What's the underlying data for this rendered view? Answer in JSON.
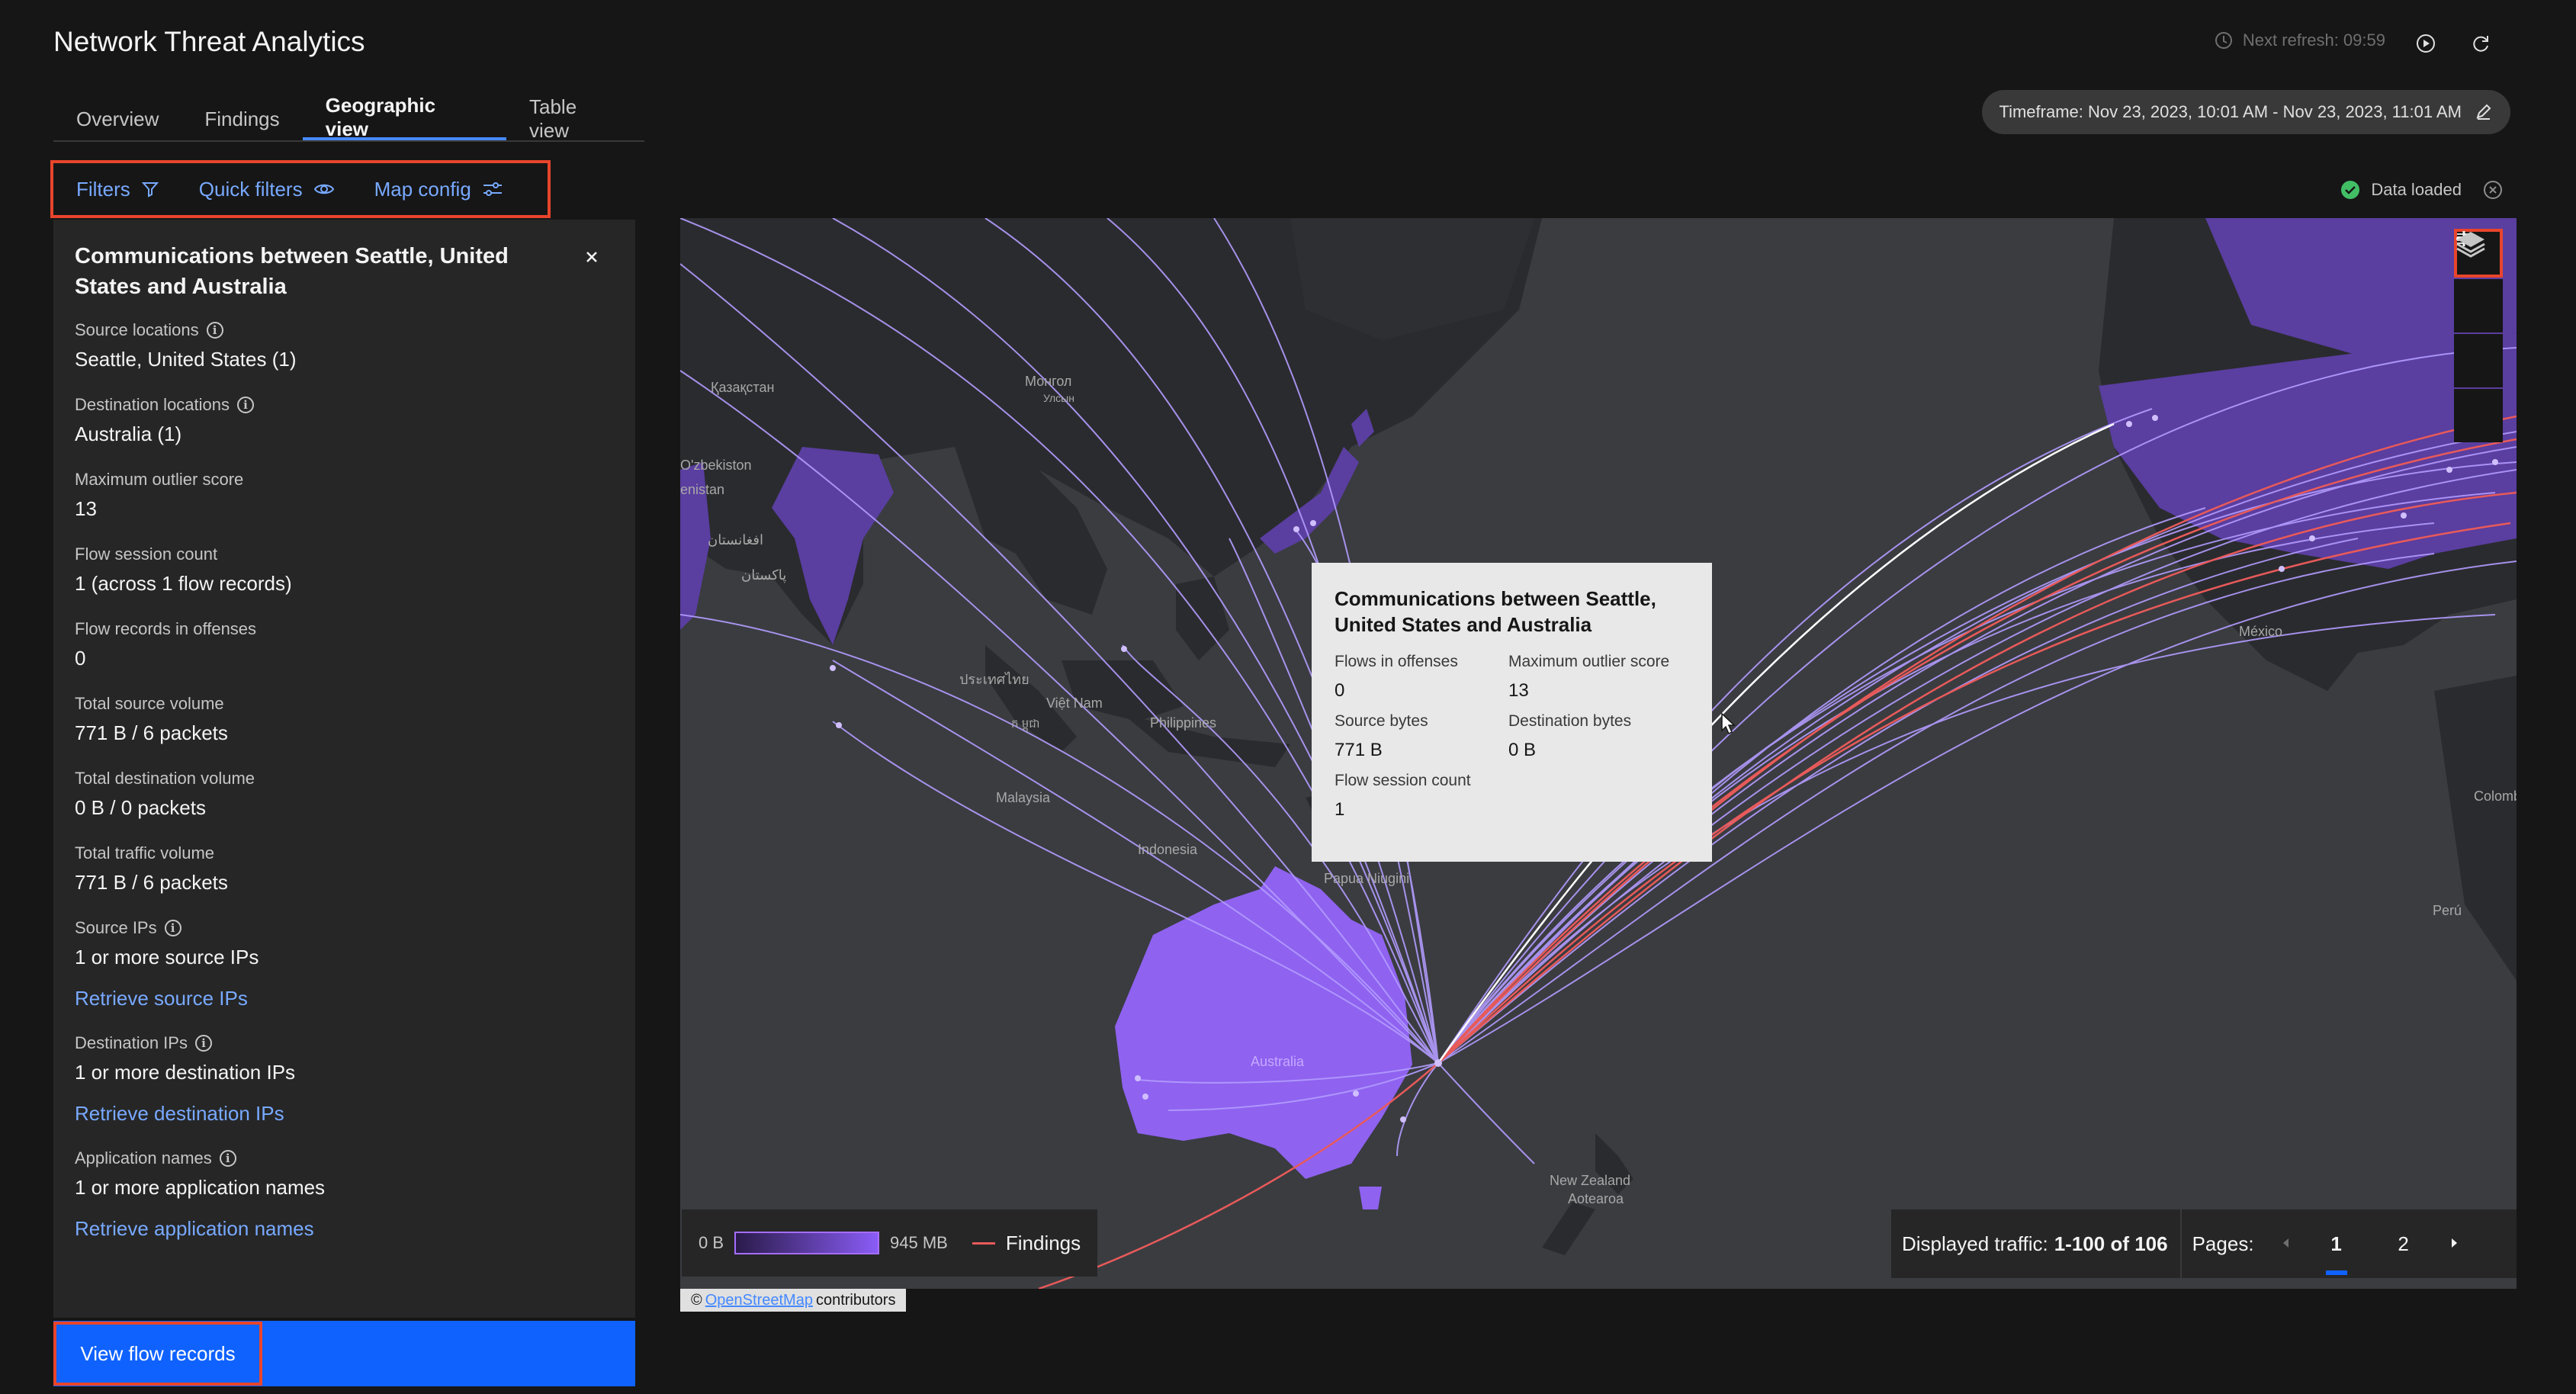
{
  "app": {
    "title": "Network Threat Analytics"
  },
  "header": {
    "next_refresh": "Next refresh: 09:59"
  },
  "tabs": [
    {
      "label": "Overview"
    },
    {
      "label": "Findings"
    },
    {
      "label": "Geographic view",
      "active": true
    },
    {
      "label": "Table view"
    }
  ],
  "timeframe": {
    "label": "Timeframe: Nov 23, 2023, 10:01 AM - Nov 23, 2023, 11:01 AM"
  },
  "filterbar": {
    "filters": "Filters",
    "quick_filters": "Quick filters",
    "map_config": "Map config"
  },
  "status": {
    "data_loaded": "Data loaded"
  },
  "panel": {
    "title": "Communications between Seattle, United States and Australia",
    "fields": {
      "source_locations": {
        "label": "Source locations",
        "value": "Seattle, United States (1)"
      },
      "destination_locations": {
        "label": "Destination locations",
        "value": "Australia (1)"
      },
      "max_outlier": {
        "label": "Maximum outlier score",
        "value": "13"
      },
      "flow_session_count": {
        "label": "Flow session count",
        "value": "1 (across 1 flow records)"
      },
      "flow_records_offenses": {
        "label": "Flow records in offenses",
        "value": "0"
      },
      "total_source_volume": {
        "label": "Total source volume",
        "value": "771 B / 6 packets"
      },
      "total_destination_volume": {
        "label": "Total destination volume",
        "value": "0 B / 0 packets"
      },
      "total_traffic_volume": {
        "label": "Total traffic volume",
        "value": "771 B / 6 packets"
      },
      "source_ips": {
        "label": "Source IPs",
        "value": "1 or more source IPs",
        "link": "Retrieve source IPs"
      },
      "destination_ips": {
        "label": "Destination IPs",
        "value": "1 or more destination IPs",
        "link": "Retrieve destination IPs"
      },
      "application_names": {
        "label": "Application names",
        "value": "1 or more application names",
        "link": "Retrieve application names"
      }
    },
    "view_flow_records": "View flow records"
  },
  "tooltip": {
    "title": "Communications between Seattle, United States and Australia",
    "flows_in_offenses": {
      "label": "Flows in offenses",
      "value": "0"
    },
    "max_outlier": {
      "label": "Maximum outlier score",
      "value": "13"
    },
    "source_bytes": {
      "label": "Source bytes",
      "value": "771 B"
    },
    "destination_bytes": {
      "label": "Destination bytes",
      "value": "0 B"
    },
    "flow_session_count": {
      "label": "Flow session count",
      "value": "1"
    }
  },
  "map": {
    "labels": {
      "kazakhstan": "Қазақстан",
      "mongolia": "Монгол",
      "mongolia_sub": "Улсын",
      "uzbekistan": "O'zbekiston",
      "uzbekistan_sub": "enistan",
      "afghanistan": "افغانستان",
      "pakistan": "پاکستان",
      "thailand": "ประเทศไทย",
      "vietnam": "Việt Nam",
      "cambodia": "ក ម្ពុជា",
      "philippines": "Philippines",
      "malaysia": "Malaysia",
      "indonesia": "Indonesia",
      "papua": "Papua Niugini",
      "australia": "Australia",
      "nz": "New Zealand",
      "nz_sub": "Aotearoa",
      "mexico": "México",
      "colombia": "Colomb",
      "peru": "Perú"
    },
    "legend": {
      "min": "0 B",
      "max": "945 MB",
      "findings": "Findings"
    },
    "attribution": {
      "prefix": "©",
      "link": "OpenStreetMap",
      "suffix": "contributors"
    },
    "colors": {
      "land": "#8f62f0",
      "flows": "#b39cff",
      "findings": "#e85a5a",
      "ocean": "#3a3c40"
    }
  },
  "pager": {
    "displayed_label": "Displayed traffic:",
    "displayed_value": "1-100 of 106",
    "pages_label": "Pages:",
    "pages": [
      "1",
      "2"
    ],
    "current": "1"
  }
}
